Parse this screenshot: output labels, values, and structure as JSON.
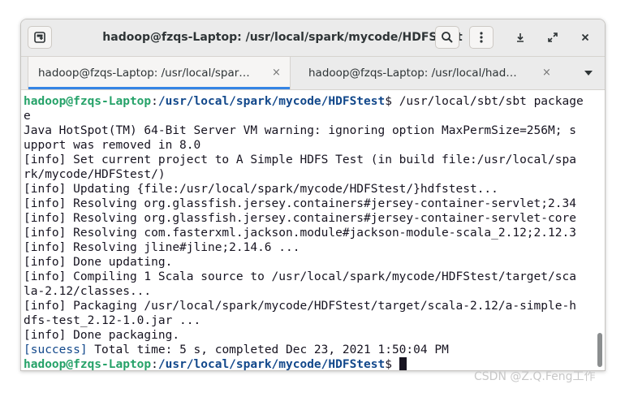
{
  "window": {
    "title": "hadoop@fzqs-Laptop: /usr/local/spark/mycode/HDFStest"
  },
  "titlebar": {
    "new_tab_icon": "new-tab-icon",
    "search_icon": "search-icon",
    "menu_icon": "kebab-menu-icon",
    "minimize_icon": "minimize-icon",
    "maximize_icon": "maximize-icon",
    "close_icon": "close-icon"
  },
  "tabs": [
    {
      "label": "hadoop@fzqs-Laptop: /usr/local/spar…",
      "close": "×",
      "active": true
    },
    {
      "label": "hadoop@fzqs-Laptop: /usr/local/had…",
      "close": "×",
      "active": false
    }
  ],
  "tab_menu_icon": "chevron-down-icon",
  "terminal": {
    "prompt_user": "hadoop@fzqs-Laptop",
    "prompt_sep": ":",
    "prompt_path": "/usr/local/spark/mycode/HDFStest",
    "prompt_symbol": "$ ",
    "command": "/usr/local/sbt/sbt package",
    "command_wrap": "e",
    "lines": [
      "Java HotSpot(TM) 64-Bit Server VM warning: ignoring option MaxPermSize=256M; s",
      "upport was removed in 8.0",
      "[info] Set current project to A Simple HDFS Test (in build file:/usr/local/spa",
      "rk/mycode/HDFStest/)",
      "[info] Updating {file:/usr/local/spark/mycode/HDFStest/}hdfstest...",
      "[info] Resolving org.glassfish.jersey.containers#jersey-container-servlet;2.34",
      "[info] Resolving org.glassfish.jersey.containers#jersey-container-servlet-core",
      "[info] Resolving com.fasterxml.jackson.module#jackson-module-scala_2.12;2.12.3",
      "[info] Resolving jline#jline;2.14.6 ...",
      "[info] Done updating.",
      "[info] Compiling 1 Scala source to /usr/local/spark/mycode/HDFStest/target/sca",
      "la-2.12/classes...",
      "[info] Packaging /usr/local/spark/mycode/HDFStest/target/scala-2.12/a-simple-h",
      "dfs-test_2.12-1.0.jar ...",
      "[info] Done packaging."
    ],
    "success_tag": "[success]",
    "success_text": " Total time: 5 s, completed Dec 23, 2021 1:50:04 PM"
  },
  "watermark": "CSDN @Z.Q.Feng工作"
}
